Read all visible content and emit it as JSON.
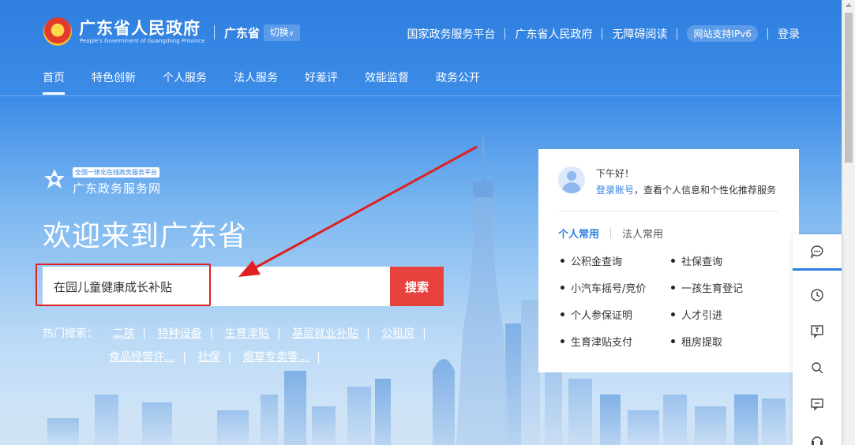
{
  "header": {
    "site_name": "广东省人民政府",
    "site_name_en": "People's Government of Guangdong Province",
    "region": "广东省",
    "switch_label": "切换",
    "links": [
      "国家政务服务平台",
      "广东省人民政府",
      "无障碍阅读",
      "网站支持IPv6",
      "登录"
    ]
  },
  "nav": {
    "items": [
      "首页",
      "特色创新",
      "个人服务",
      "法人服务",
      "好差评",
      "效能监督",
      "政务公开"
    ]
  },
  "hero": {
    "tag": "全国一体化在线政务服务平台",
    "service_name": "广东政务服务网",
    "welcome": "欢迎来到广东省",
    "search_value": "在园儿童健康成长补贴",
    "search_button": "搜索",
    "hot_label": "热门搜索：",
    "hot_items": [
      "二孩",
      "特种设备",
      "生育津贴",
      "基层就业补贴",
      "公租房",
      "食品经营许...",
      "社保",
      "烟草专卖零..."
    ]
  },
  "card": {
    "greeting": "下午好！",
    "login_link": "登录账号",
    "login_tip": "，查看个人信息和个性化推荐服务",
    "tabs": [
      "个人常用",
      "法人常用"
    ],
    "services": [
      "公积金查询",
      "社保查询",
      "小汽车摇号/竞价",
      "一孩生育登记",
      "个人参保证明",
      "人才引进",
      "生育津贴支付",
      "租房提取"
    ]
  },
  "floatbar": {
    "icons": [
      "chat-icon",
      "history-icon",
      "feedback-icon",
      "search-icon",
      "comment-icon",
      "headset-icon"
    ]
  },
  "colors": {
    "brand_blue": "#2f7fe0",
    "search_red": "#e8423f",
    "annotation_red": "#e02020"
  }
}
